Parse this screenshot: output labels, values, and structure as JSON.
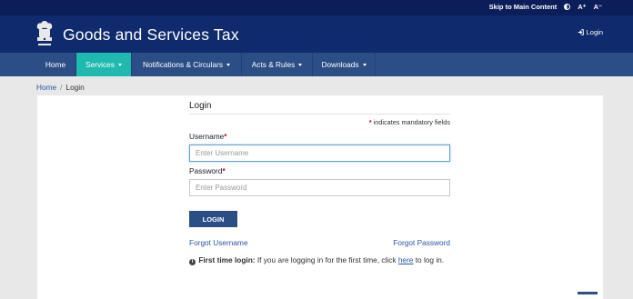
{
  "topbar": {
    "skip_link": "Skip to Main Content",
    "font_increase": "A⁺",
    "font_decrease": "A⁻"
  },
  "header": {
    "title": "Goods and Services Tax",
    "login_label": "Login"
  },
  "nav": {
    "items": [
      {
        "label": "Home"
      },
      {
        "label": "Services"
      },
      {
        "label": "Notifications & Circulars"
      },
      {
        "label": "Acts & Rules"
      },
      {
        "label": "Downloads"
      }
    ]
  },
  "breadcrumb": {
    "home": "Home",
    "current": "Login"
  },
  "form": {
    "title": "Login",
    "mandatory_note": "indicates mandatory fields",
    "username_label": "Username",
    "username_placeholder": "Enter Username",
    "username_value": "",
    "password_label": "Password",
    "password_placeholder": "Enter Password",
    "password_value": "",
    "required_marker": "*",
    "login_button": "LOGIN",
    "forgot_username": "Forgot Username",
    "forgot_password": "Forgot Password",
    "first_time_bold": "First time login:",
    "first_time_text": "If you are logging in for the first time, click",
    "first_time_link": "here",
    "first_time_tail": "to log in."
  },
  "colors": {
    "header": "#0f2b6d",
    "nav": "#2c4e86",
    "nav_active": "#20b9b0",
    "link": "#2a56a8",
    "required": "#d0021b"
  }
}
